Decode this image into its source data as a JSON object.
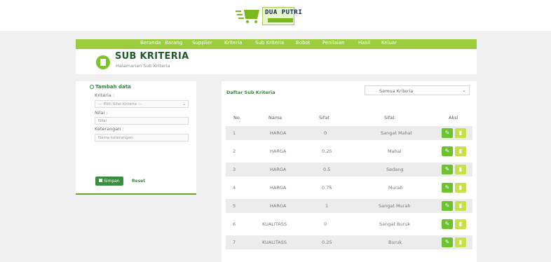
{
  "brand": {
    "name": "DUA PUTRI"
  },
  "nav": [
    "Beranda",
    "Barang",
    "Supplier",
    "Kriteria",
    "Sub Kriteria",
    "Bobot",
    "Penilaian",
    "Hasil",
    "Keluar"
  ],
  "header": {
    "title": "SUB KRITERIA",
    "subtitle": "Halamanan Sub Kriteria"
  },
  "form": {
    "title": "Tambah data",
    "kriteria_label": "Kriteria :",
    "kriteria_value": "--- Pilih Sifat Kriteria ---",
    "nilai_label": "Nilai :",
    "nilai_placeholder": "Nilai",
    "keterangan_label": "Keterangan :",
    "keterangan_placeholder": "Nama keterangan",
    "save_label": "Simpan",
    "reset_label": "Reset"
  },
  "list": {
    "title": "Daftar Sub Kriteria",
    "filter_value": "Semua Kriteria",
    "headers": [
      "No",
      "Nama",
      "Sifat",
      "Sifat",
      "Aksi"
    ],
    "rows": [
      {
        "no": "1",
        "nama": "HARGA",
        "nilai": "0",
        "sifat": "Sangat Mahal"
      },
      {
        "no": "2",
        "nama": "HARGA",
        "nilai": "0.25",
        "sifat": "Mahal"
      },
      {
        "no": "3",
        "nama": "HARGA",
        "nilai": "0.5",
        "sifat": "Sedang"
      },
      {
        "no": "4",
        "nama": "HARGA",
        "nilai": "0.75",
        "sifat": "Murah"
      },
      {
        "no": "5",
        "nama": "HARGA",
        "nilai": "1",
        "sifat": "Sangat Murah"
      },
      {
        "no": "6",
        "nama": "KUALITASS",
        "nilai": "0",
        "sifat": "Sangat Buruk"
      },
      {
        "no": "7",
        "nama": "KUALITASS",
        "nilai": "0.25",
        "sifat": "Buruk"
      }
    ]
  },
  "colors": {
    "accent": "#9ccd3d",
    "dark_green": "#3a8c3f",
    "edit": "#6cc22f",
    "delete": "#c8e04a"
  }
}
